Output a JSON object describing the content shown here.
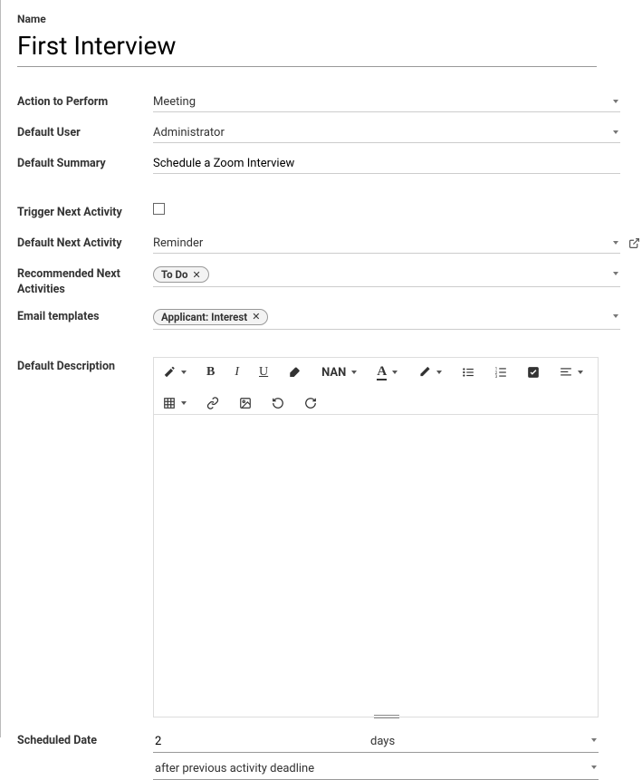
{
  "labels": {
    "name": "Name",
    "action": "Action to Perform",
    "default_user": "Default User",
    "default_summary": "Default Summary",
    "trigger_next": "Trigger Next Activity",
    "default_next": "Default Next Activity",
    "recommended": "Recommended Next Activities",
    "email_templates": "Email templates",
    "default_description": "Default Description",
    "scheduled_date": "Scheduled Date"
  },
  "values": {
    "name": "First Interview",
    "action": "Meeting",
    "default_user": "Administrator",
    "default_summary": "Schedule a Zoom Interview",
    "trigger_next": false,
    "default_next": "Reminder",
    "recommended_tag": "To Do",
    "email_template_tag": "Applicant: Interest",
    "scheduled_count": "2",
    "scheduled_unit": "days",
    "scheduled_relation": "after previous activity deadline"
  },
  "editor_toolbar": {
    "font_label": "NAN"
  }
}
